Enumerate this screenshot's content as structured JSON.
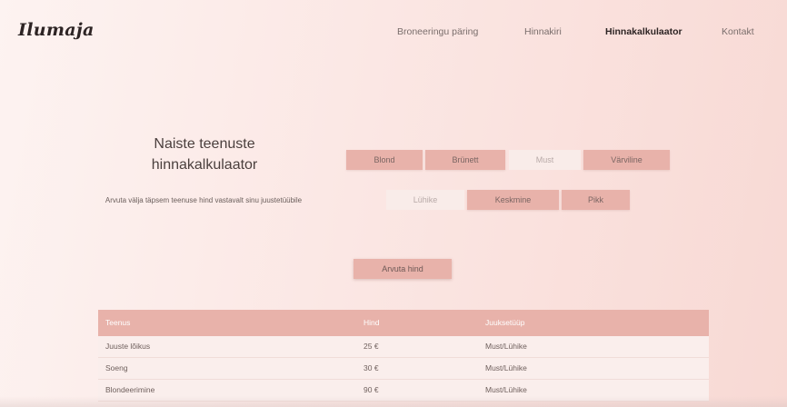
{
  "header": {
    "logo": "Ilumaja",
    "nav": [
      "Broneeringu päring",
      "Hinnakiri",
      "Hinnakalkulaator",
      "Kontakt"
    ],
    "active_nav": "Hinnakalkulaator"
  },
  "calculator": {
    "title": "Naiste teenuste hinnakalkulaator",
    "subtitle": "Arvuta välja täpsem teenuse hind vastavalt sinu juustetüübile",
    "hair_colors": [
      "Blond",
      "Brünett",
      "Must",
      "Värviline"
    ],
    "selected_color": "Must",
    "hair_lengths": [
      "Lühike",
      "Keskmine",
      "Pikk"
    ],
    "selected_length": "Lühike",
    "button": "Arvuta hind"
  },
  "table": {
    "headers": [
      "Teenus",
      "Hind",
      "Juuksetüüp"
    ],
    "rows": [
      [
        "Juuste lõikus",
        "25 €",
        "Must/Lühike"
      ],
      [
        "Soeng",
        "30 €",
        "Must/Lühike"
      ],
      [
        "Blondeerimine",
        "90 €",
        "Must/Lühike"
      ]
    ]
  },
  "colors": {
    "accent": "#e8b2aa",
    "selected_option": "#f9ece9",
    "text_dark": "#2d2424"
  }
}
